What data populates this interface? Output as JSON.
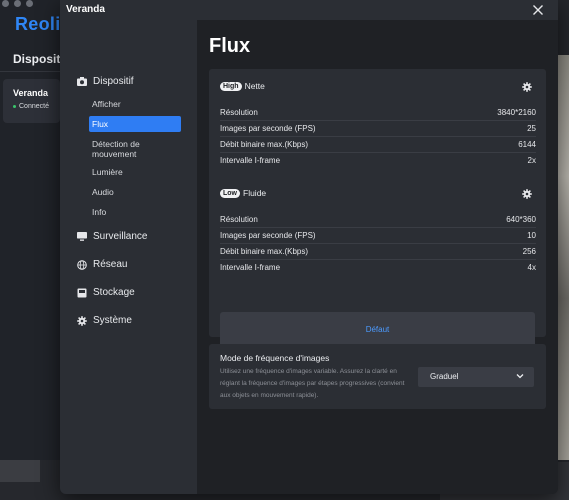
{
  "background": {
    "logo": "Reolin",
    "section_title": "Dispositif",
    "device_name": "Veranda",
    "device_status": "Connecté"
  },
  "modal": {
    "title": "Veranda"
  },
  "sidebar": {
    "groups": [
      {
        "label": "Dispositif",
        "icon": "camera-icon"
      },
      {
        "label": "Surveillance",
        "icon": "monitor-icon"
      },
      {
        "label": "Réseau",
        "icon": "globe-icon"
      },
      {
        "label": "Stockage",
        "icon": "storage-icon"
      },
      {
        "label": "Système",
        "icon": "gear-icon"
      }
    ],
    "sub_items": [
      {
        "label": "Afficher"
      },
      {
        "label": "Flux",
        "active": true
      },
      {
        "label": "Détection de mouvement"
      },
      {
        "label": "Lumière"
      },
      {
        "label": "Audio"
      },
      {
        "label": "Info"
      }
    ]
  },
  "page": {
    "title": "Flux"
  },
  "streams": [
    {
      "badge": "High",
      "name": "Nette",
      "rows": [
        {
          "label": "Résolution",
          "value": "3840*2160"
        },
        {
          "label": "Images par seconde (FPS)",
          "value": "25"
        },
        {
          "label": "Débit binaire max.(Kbps)",
          "value": "6144"
        },
        {
          "label": "Intervalle I-frame",
          "value": "2x"
        }
      ]
    },
    {
      "badge": "Low",
      "name": "Fluide",
      "rows": [
        {
          "label": "Résolution",
          "value": "640*360"
        },
        {
          "label": "Images par seconde (FPS)",
          "value": "10"
        },
        {
          "label": "Débit binaire max.(Kbps)",
          "value": "256"
        },
        {
          "label": "Intervalle I-frame",
          "value": "4x"
        }
      ]
    }
  ],
  "default_button": "Défaut",
  "frame_rate_mode": {
    "title": "Mode de fréquence d'images",
    "description": "Utilisez une fréquence d'images variable. Assurez la clarté en réglant la fréquence d'images par étapes progressives (convient aux objets en mouvement rapide).",
    "selected": "Graduel"
  },
  "colors": {
    "accent": "#2f7df3",
    "link": "#4c9bff",
    "brand": "#2f86f6",
    "status_online": "#3ac46b"
  }
}
